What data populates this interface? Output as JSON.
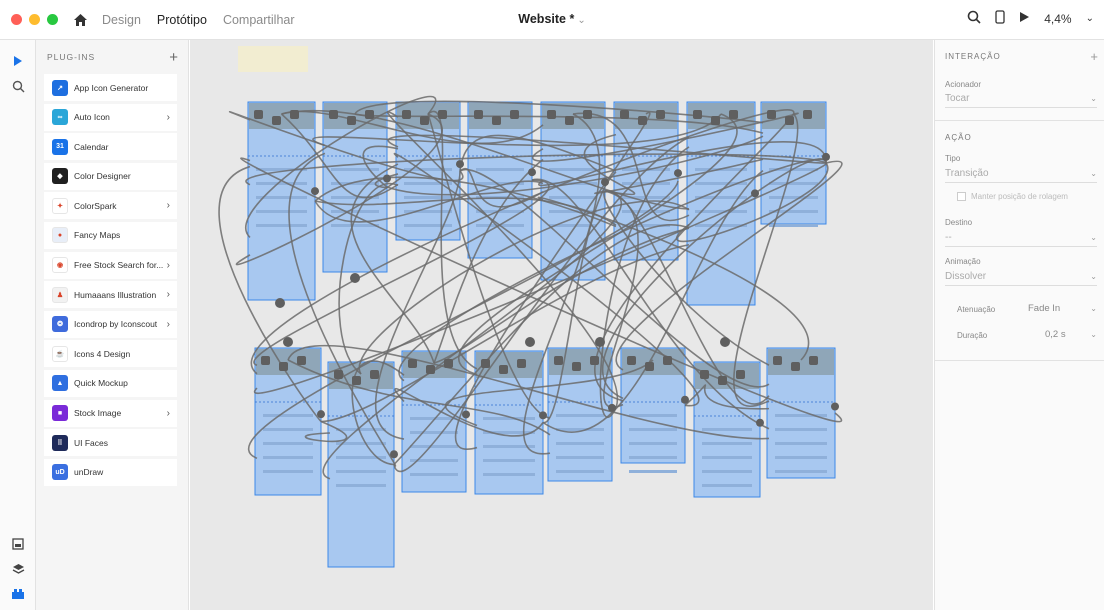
{
  "topbar": {
    "traffic_colors": [
      "#ff5f57",
      "#febc2e",
      "#28c840"
    ],
    "tabs": [
      {
        "label": "Design"
      },
      {
        "label": "Protótipo"
      },
      {
        "label": "Compartilhar"
      }
    ],
    "document_title": "Website *",
    "zoom_level": "4,4%",
    "icons": [
      "user-search-icon",
      "mobile-preview-icon",
      "play-icon",
      "chevron-down-icon"
    ]
  },
  "toolstrip": {
    "tools": [
      "select-arrow-icon",
      "search-icon"
    ],
    "bottom_tools": [
      "assets-icon",
      "layers-icon",
      "plugins-icon"
    ]
  },
  "plugins": {
    "title": "PLUG-INS",
    "add_label": "+",
    "items": [
      {
        "label": "App Icon Generator",
        "icon": "app-icon-generator-icon",
        "color": "#1e6fe0",
        "glyph": "↗",
        "submenu": false
      },
      {
        "label": "Auto Icon",
        "icon": "auto-icon-icon",
        "color": "#2aa6d8",
        "glyph": "∞",
        "submenu": true
      },
      {
        "label": "Calendar",
        "icon": "calendar-icon",
        "color": "#1a73e8",
        "glyph": "31",
        "submenu": false
      },
      {
        "label": "Color Designer",
        "icon": "color-designer-icon",
        "color": "#202020",
        "glyph": "◆",
        "submenu": false
      },
      {
        "label": "ColorSpark",
        "icon": "colorspark-icon",
        "color": "#ffffff",
        "glyph": "✦",
        "submenu": true
      },
      {
        "label": "Fancy Maps",
        "icon": "fancy-maps-icon",
        "color": "#e8eef8",
        "glyph": "●",
        "submenu": false
      },
      {
        "label": "Free Stock Search for...",
        "icon": "free-stock-search-icon",
        "color": "#ffffff",
        "glyph": "◉",
        "submenu": true
      },
      {
        "label": "Humaaans Illustration",
        "icon": "humaaans-icon",
        "color": "#f2f2f2",
        "glyph": "♟",
        "submenu": true
      },
      {
        "label": "Icondrop by Iconscout",
        "icon": "icondrop-icon",
        "color": "#3f6bdc",
        "glyph": "❂",
        "submenu": true
      },
      {
        "label": "Icons 4 Design",
        "icon": "icons-4-design-icon",
        "color": "#ffffff",
        "glyph": "☕",
        "submenu": false
      },
      {
        "label": "Quick Mockup",
        "icon": "quick-mockup-icon",
        "color": "#2f6fe0",
        "glyph": "▲",
        "submenu": false
      },
      {
        "label": "Stock Image",
        "icon": "stock-image-icon",
        "color": "#7a2ad8",
        "glyph": "■",
        "submenu": true
      },
      {
        "label": "UI Faces",
        "icon": "ui-faces-icon",
        "color": "#1e2a5a",
        "glyph": "⠿",
        "submenu": false
      },
      {
        "label": "unDraw",
        "icon": "undraw-icon",
        "color": "#3a6fe0",
        "glyph": "uD",
        "submenu": false
      }
    ]
  },
  "canvas": {
    "background": "#e8e8e8",
    "artboard_fill": "#a8c8f0",
    "artboard_border": "#3b87e8",
    "wire_color": "#6b6b6b"
  },
  "properties": {
    "interaction_title": "INTERAÇÃO",
    "add_label": "+",
    "trigger_label": "Acionador",
    "trigger_value": "Tocar",
    "action_title": "AÇÃO",
    "type_label": "Tipo",
    "type_value": "Transição",
    "preserve_scroll_label": "Manter posição de rolagem",
    "destination_label": "Destino",
    "destination_value": "--",
    "animation_label": "Animação",
    "animation_value": "Dissolver",
    "easing_label": "Atenuação",
    "easing_value": "Fade In",
    "duration_label": "Duração",
    "duration_value": "0,2 s"
  }
}
